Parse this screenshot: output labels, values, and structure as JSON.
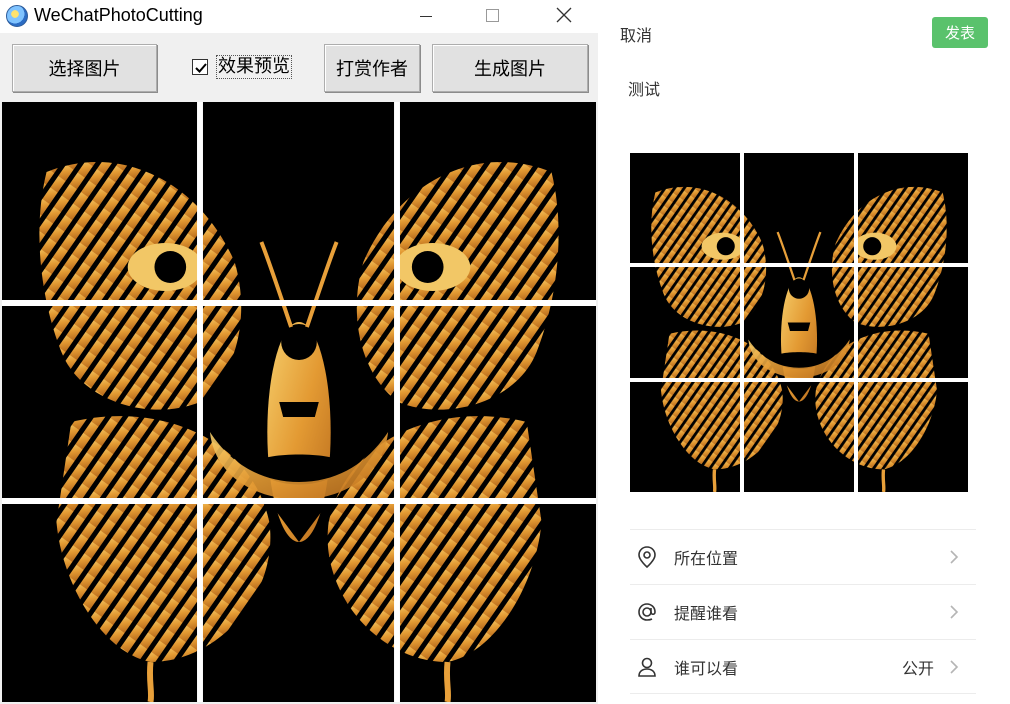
{
  "app": {
    "title": "WeChatPhotoCutting",
    "buttons": {
      "select_image": "选择图片",
      "reward_author": "打赏作者",
      "generate_image": "生成图片"
    },
    "preview_checkbox": {
      "label": "效果预览",
      "checked": true
    }
  },
  "moments": {
    "cancel": "取消",
    "publish": "发表",
    "post_text": "测试",
    "rows": [
      {
        "label": "所在位置",
        "icon": "location-pin-icon",
        "value": ""
      },
      {
        "label": "提醒谁看",
        "icon": "at-sign-icon",
        "value": ""
      },
      {
        "label": "谁可以看",
        "icon": "person-icon",
        "value": "公开"
      }
    ]
  },
  "colors": {
    "publish_green": "#5ac26c",
    "pattern_orange": "#e8a03a",
    "pattern_gold": "#f2c766"
  }
}
